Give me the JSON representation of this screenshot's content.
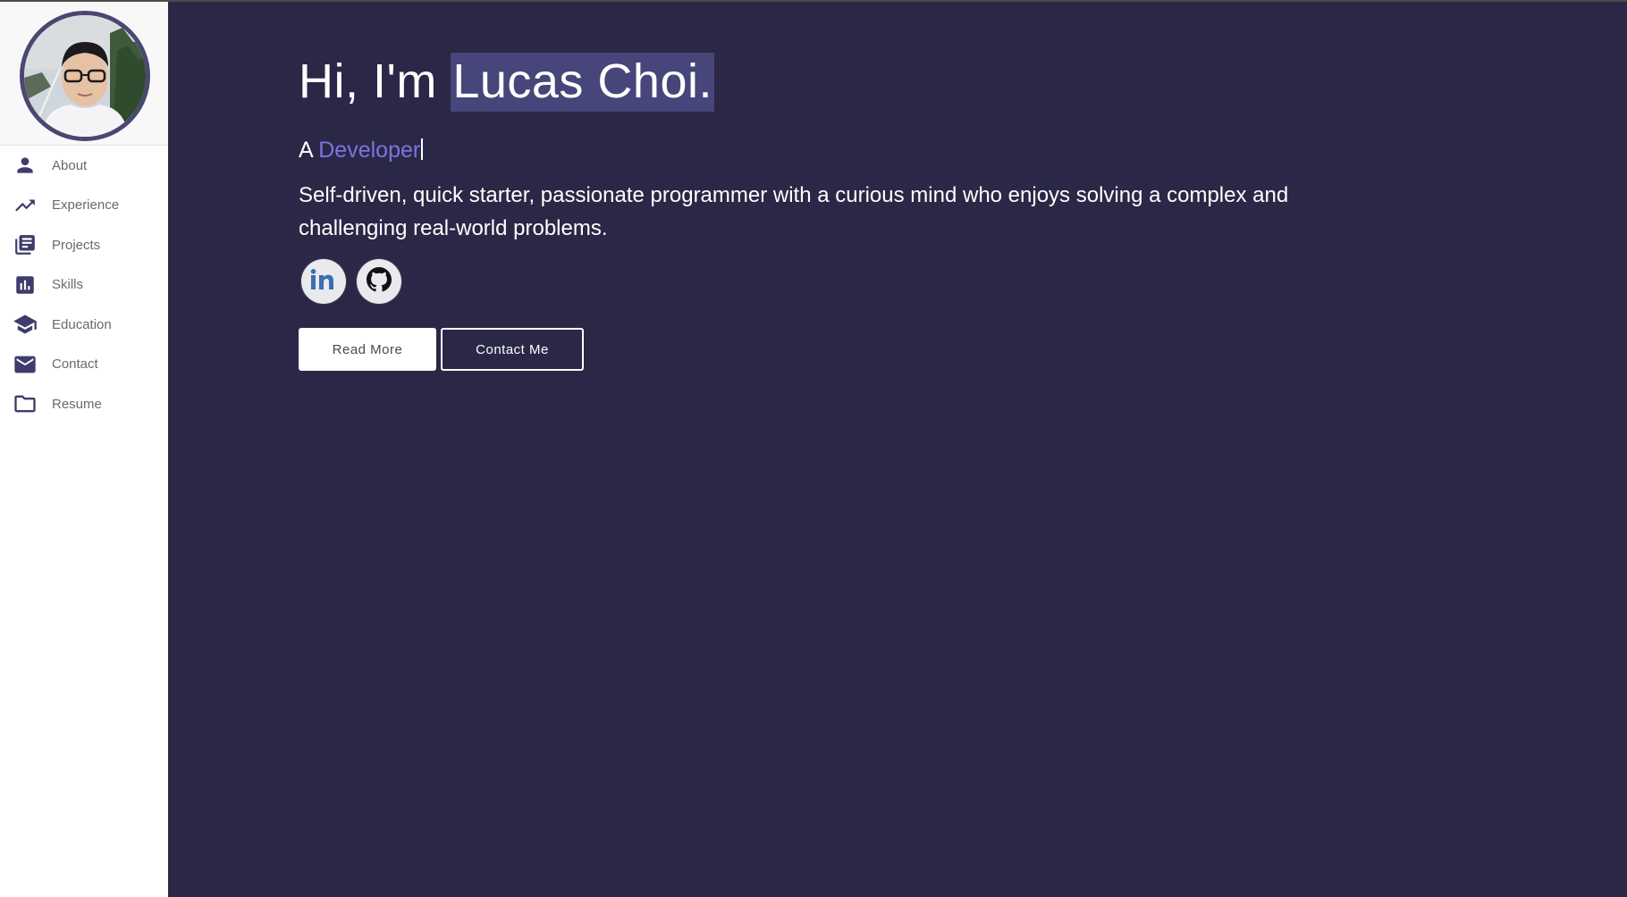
{
  "profile": {
    "photo_alt": "Lucas Choi"
  },
  "sidebar": {
    "items": [
      {
        "label": "About",
        "icon": "person-icon"
      },
      {
        "label": "Experience",
        "icon": "trending-up-icon"
      },
      {
        "label": "Projects",
        "icon": "library-books-icon"
      },
      {
        "label": "Skills",
        "icon": "bar-chart-icon"
      },
      {
        "label": "Education",
        "icon": "school-icon"
      },
      {
        "label": "Contact",
        "icon": "mail-icon"
      },
      {
        "label": "Resume",
        "icon": "folder-icon"
      }
    ]
  },
  "hero": {
    "greeting": "Hi, I'm ",
    "name": "Lucas Choi.",
    "subtitle_prefix": "A ",
    "role": "Developer",
    "bio": "Self-driven, quick starter, passionate programmer with a curious mind who enjoys solving a complex and challenging real-world problems."
  },
  "socials": [
    {
      "icon": "linkedin-icon"
    },
    {
      "icon": "github-icon"
    }
  ],
  "buttons": {
    "read_more": "Read More",
    "contact_me": "Contact Me"
  },
  "colors": {
    "background": "#2a2846",
    "accent": "#7b74e0",
    "name_highlight": "#46467a",
    "icon": "#3f3c6b"
  }
}
